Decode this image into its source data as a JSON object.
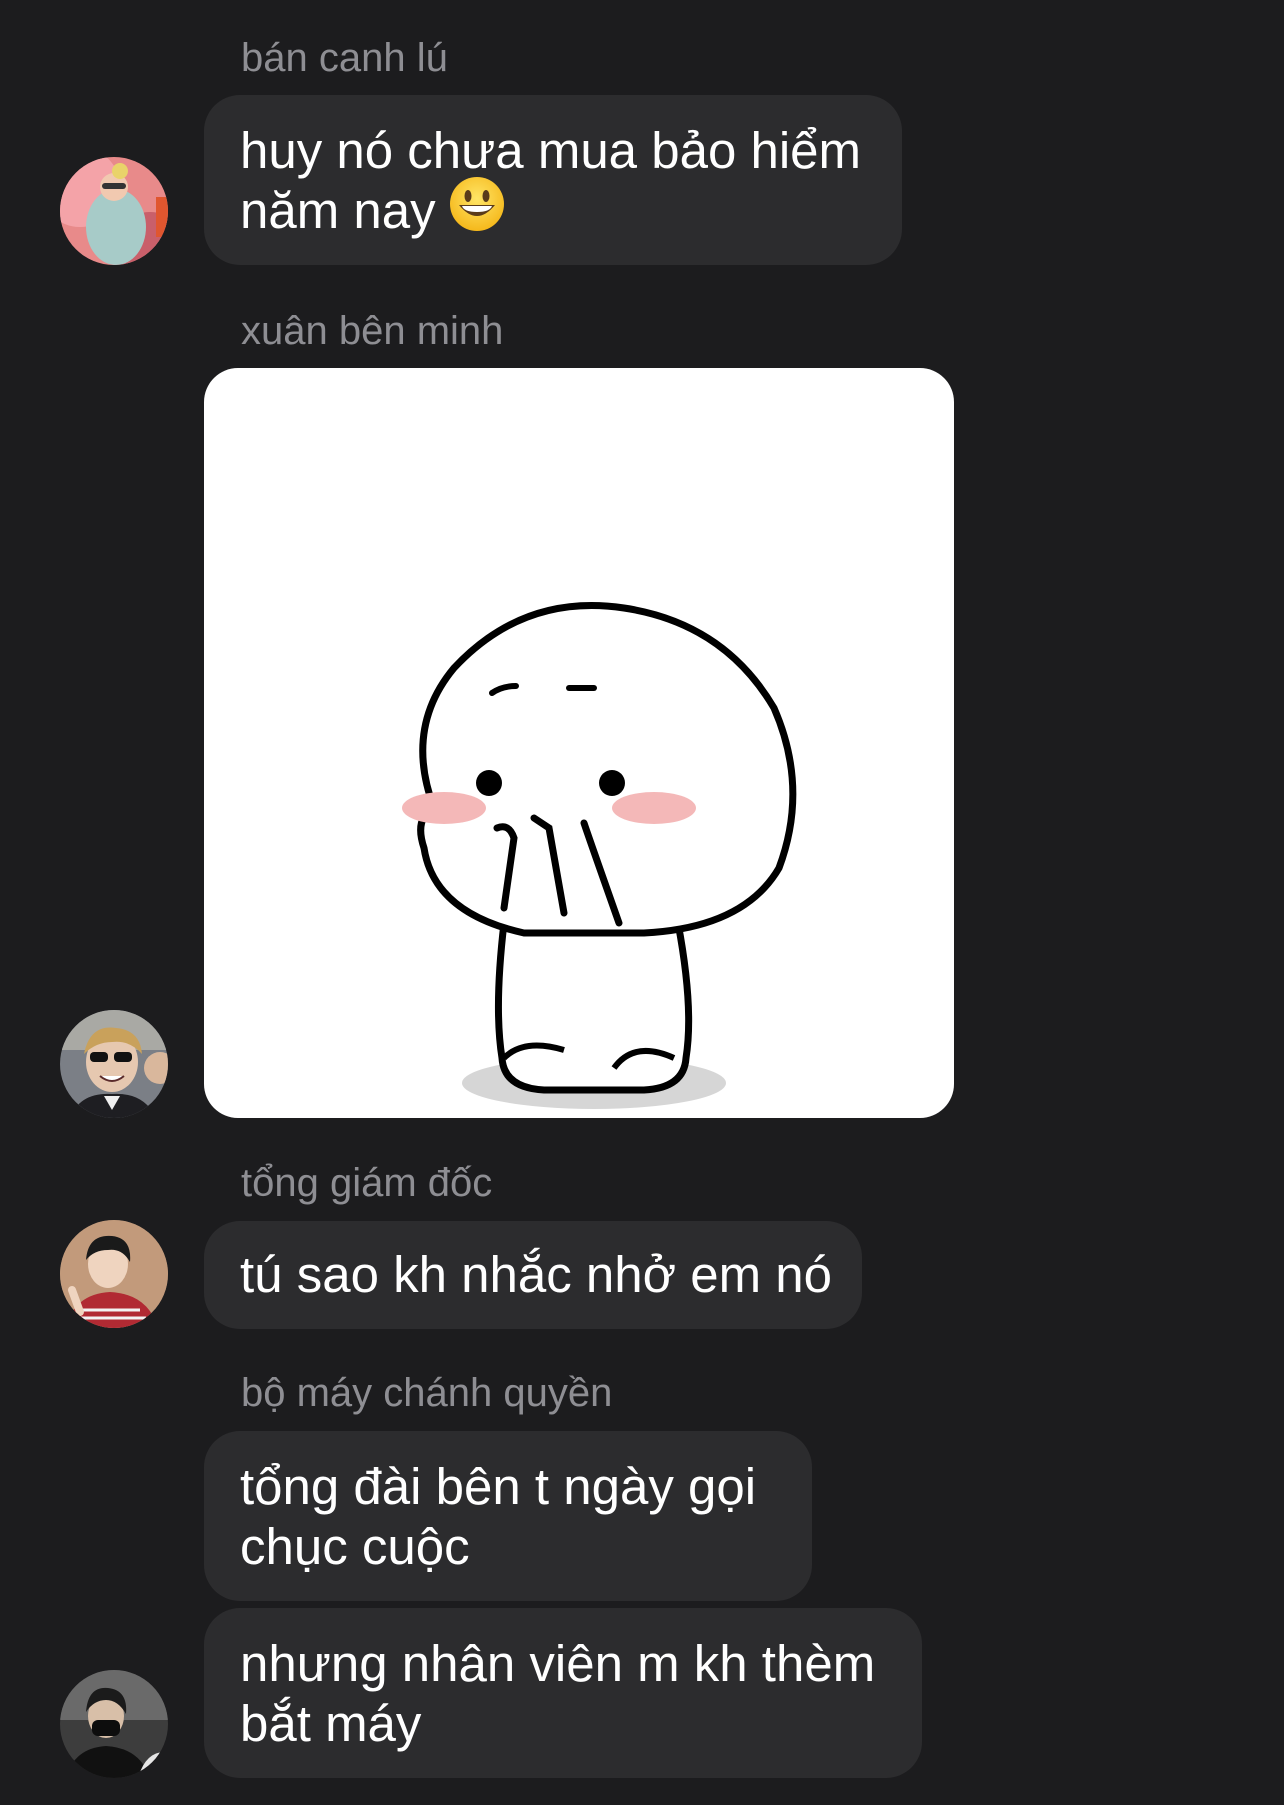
{
  "messages": [
    {
      "sender": "bán canh lú",
      "lines": [
        "huy nó chưa mua bảo hiểm",
        "năm nay"
      ],
      "emoji": "grinning-face"
    },
    {
      "sender": "xuân bên minh",
      "sticker": "shy-white-blob-sticker"
    },
    {
      "sender": "tổng giám đốc",
      "lines": [
        "tú sao kh nhắc nhở em nó"
      ]
    },
    {
      "sender": "bộ máy chánh quyền",
      "lines": [
        "tổng đài bên t ngày gọi",
        "chục cuộc"
      ]
    },
    {
      "lines": [
        "nhưng nhân viên m kh thèm",
        "bắt máy"
      ]
    }
  ],
  "colors": {
    "background": "#1c1c1e",
    "bubble": "#2c2c2e",
    "sender_text": "#8e8e93",
    "message_text": "#ffffff"
  }
}
